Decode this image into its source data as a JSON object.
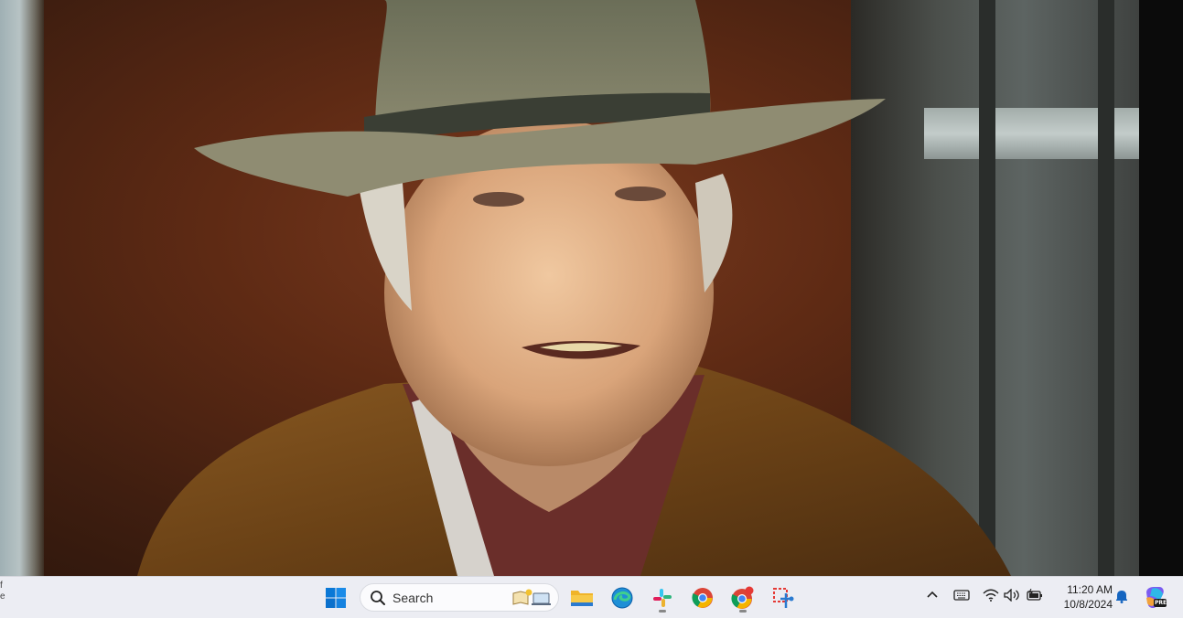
{
  "taskbar": {
    "edge_text_line1": "f",
    "edge_text_line2": "e",
    "search": {
      "placeholder": "Search"
    },
    "pinned_apps": [
      {
        "name": "Start",
        "icon": "windows-start-icon"
      },
      {
        "name": "File Explorer",
        "icon": "folder-icon"
      },
      {
        "name": "Microsoft Edge",
        "icon": "edge-icon"
      },
      {
        "name": "Slack",
        "icon": "slack-icon"
      },
      {
        "name": "Google Chrome",
        "icon": "chrome-icon"
      },
      {
        "name": "Google Chrome (profile)",
        "icon": "chrome-profile-icon"
      },
      {
        "name": "Snipping Tool",
        "icon": "snipping-tool-icon"
      }
    ],
    "tray": {
      "overflow": "^",
      "icons": [
        "keyboard-icon",
        "wifi-icon",
        "volume-icon",
        "battery-icon",
        "notification-bell-icon",
        "copilot-icon"
      ]
    },
    "clock": {
      "time": "11:20 AM",
      "date": "10/8/2024"
    },
    "copilot_badge": "PRE"
  },
  "colors": {
    "taskbar_bg": "#ecedf3",
    "accent_blue": "#0078d4"
  }
}
